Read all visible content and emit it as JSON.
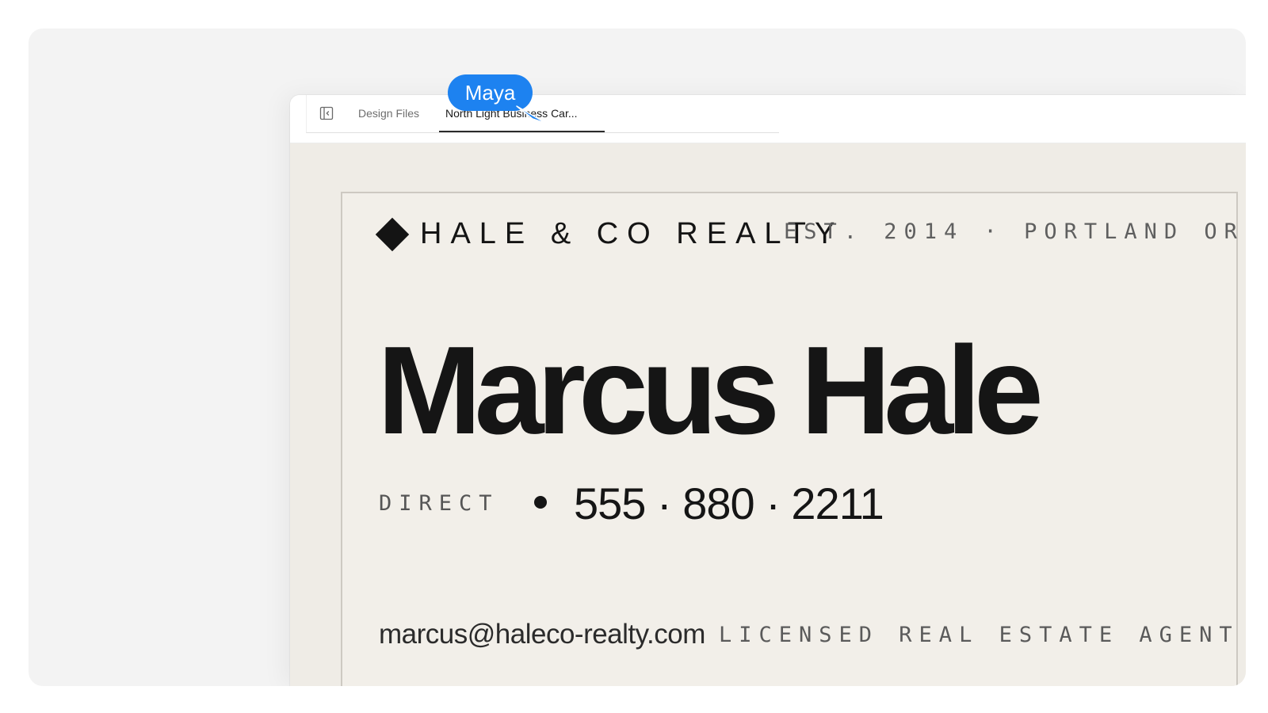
{
  "tabs": {
    "sidebar_toggle_icon": "sidebar-toggle-icon",
    "design_files_label": "Design Files",
    "active_label": "North Light Business Car..."
  },
  "collaborator": {
    "name": "Maya",
    "color": "#1d82f0"
  },
  "card": {
    "brand": "HALE & CO REALTY",
    "established": "EST. 2014 · PORTLAND OR",
    "name": "Marcus Hale",
    "direct_label": "DIRECT",
    "phone": "555 · 880 · 2211",
    "email": "marcus@haleco-realty.com",
    "title": "LICENSED REAL ESTATE AGENT"
  }
}
